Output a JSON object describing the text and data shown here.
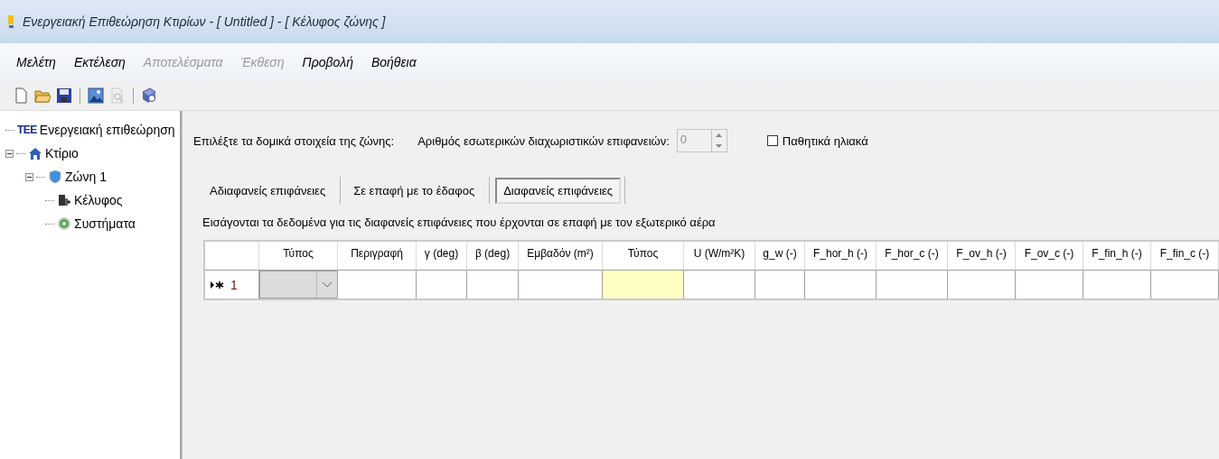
{
  "window": {
    "title": "Ενεργειακή Επιθεώρηση Κτιρίων - [ Untitled ] - [ Κέλυφος ζώνης ]"
  },
  "menu": [
    {
      "label": "Μελέτη",
      "disabled": false
    },
    {
      "label": "Εκτέλεση",
      "disabled": false
    },
    {
      "label": "Αποτελέσματα",
      "disabled": true
    },
    {
      "label": "Έκθεση",
      "disabled": true
    },
    {
      "label": "Προβολή",
      "disabled": false
    },
    {
      "label": "Βοήθεια",
      "disabled": false
    }
  ],
  "toolbar": [
    {
      "kind": "new",
      "disabled": false
    },
    {
      "kind": "open",
      "disabled": false
    },
    {
      "kind": "save",
      "disabled": false
    },
    {
      "kind": "separator"
    },
    {
      "kind": "image",
      "disabled": false
    },
    {
      "kind": "preview",
      "disabled": true
    },
    {
      "kind": "separator"
    },
    {
      "kind": "help",
      "disabled": false
    }
  ],
  "tree": [
    {
      "kind": "root",
      "logo": "ΤΕΕ",
      "label": "Ενεργειακή επιθεώρηση"
    },
    {
      "kind": "building",
      "label": "Κτίριο",
      "expanded": true,
      "children": [
        {
          "kind": "zone",
          "label": "Ζώνη 1",
          "expanded": true,
          "children": [
            {
              "kind": "envelope",
              "label": "Κέλυφος"
            },
            {
              "kind": "systems",
              "label": "Συστήματα"
            }
          ]
        }
      ]
    }
  ],
  "form": {
    "elements_label": "Επιλέξτε τα δομικά στοιχεία της ζώνης:",
    "partitions_label": "Αριθμός εσωτερικών διαχωριστικών επιφανειών:",
    "partitions_value": "0",
    "partitions_disabled": true,
    "solar": {
      "label": "Παθητικά ηλιακά",
      "checked": false
    }
  },
  "tabs": [
    {
      "label": "Αδιαφανείς επιφάνειες",
      "selected": false
    },
    {
      "label": "Σε επαφή με το έδαφος",
      "selected": false
    },
    {
      "label": "Διαφανείς επιφάνειες",
      "selected": true
    }
  ],
  "description": "Εισάγονται τα δεδομένα για τις διαφανείς επιφάνειες που έρχονται σε επαφή με τον εξωτερικό αέρα",
  "table": {
    "columns": [
      {
        "label": "Τύπος",
        "kind": "combo"
      },
      {
        "label": "Περιγραφή",
        "kind": "text"
      },
      {
        "label": "γ (deg)",
        "kind": "text"
      },
      {
        "label": "β (deg)",
        "kind": "text"
      },
      {
        "label": "Εμβαδόν (m²)",
        "kind": "text"
      },
      {
        "label": "Τύπος",
        "kind": "highlighted"
      },
      {
        "label": "U (W/m²K)",
        "kind": "text"
      },
      {
        "label": "g_w (-)",
        "kind": "text"
      },
      {
        "label": "F_hor_h (-)",
        "kind": "text"
      },
      {
        "label": "F_hor_c (-)",
        "kind": "text"
      },
      {
        "label": "F_ov_h (-)",
        "kind": "text"
      },
      {
        "label": "F_ov_c (-)",
        "kind": "text"
      },
      {
        "label": "F_fin_h (-)",
        "kind": "text"
      },
      {
        "label": "F_fin_c (-)",
        "kind": "text"
      }
    ],
    "rows": [
      {
        "number": "1",
        "current": true,
        "new": true
      }
    ]
  }
}
